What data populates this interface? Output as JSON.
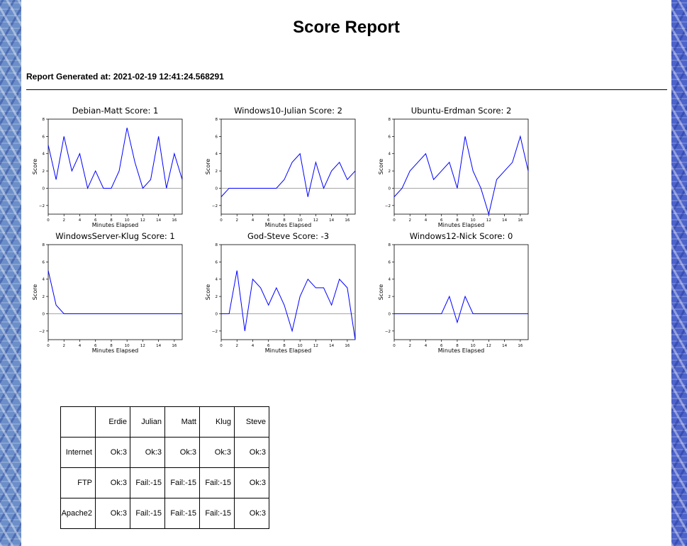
{
  "page": {
    "title": "Score Report",
    "generated_label": "Report Generated at: 2021-02-19 12:41:24.568291"
  },
  "colors": {
    "line": "#0000ff",
    "zero_line": "#999999",
    "frame": "#000000"
  },
  "chart_data": [
    {
      "type": "line",
      "title": "Debian-Matt Score: 1",
      "xlabel": "Minutes Elapsed",
      "ylabel": "Score",
      "x": [
        0,
        1,
        2,
        3,
        4,
        5,
        6,
        7,
        8,
        9,
        10,
        11,
        12,
        13,
        14,
        15,
        16,
        17
      ],
      "series": [
        {
          "values": [
            5,
            1,
            6,
            2,
            4,
            0,
            2,
            0,
            0,
            2,
            7,
            3,
            0,
            1,
            6,
            0,
            4,
            1
          ]
        }
      ],
      "xlim": [
        0,
        17
      ],
      "ylim": [
        -3,
        8
      ],
      "xticks": [
        0,
        2,
        4,
        6,
        8,
        10,
        12,
        14,
        16
      ],
      "yticks": [
        -2,
        0,
        2,
        4,
        6,
        8
      ],
      "grid": false
    },
    {
      "type": "line",
      "title": "Windows10-Julian Score: 2",
      "xlabel": "Minutes Elapsed",
      "ylabel": "Score",
      "x": [
        0,
        1,
        2,
        3,
        4,
        5,
        6,
        7,
        8,
        9,
        10,
        11,
        12,
        13,
        14,
        15,
        16,
        17
      ],
      "series": [
        {
          "values": [
            -1,
            0,
            0,
            0,
            0,
            0,
            0,
            0,
            1,
            3,
            4,
            -1,
            3,
            0,
            2,
            3,
            1,
            2
          ]
        }
      ],
      "xlim": [
        0,
        17
      ],
      "ylim": [
        -3,
        8
      ],
      "xticks": [
        0,
        2,
        4,
        6,
        8,
        10,
        12,
        14,
        16
      ],
      "yticks": [
        -2,
        0,
        2,
        4,
        6,
        8
      ],
      "grid": false
    },
    {
      "type": "line",
      "title": "Ubuntu-Erdman Score: 2",
      "xlabel": "Minutes Elapsed",
      "ylabel": "Score",
      "x": [
        0,
        1,
        2,
        3,
        4,
        5,
        6,
        7,
        8,
        9,
        10,
        11,
        12,
        13,
        14,
        15,
        16,
        17
      ],
      "series": [
        {
          "values": [
            -1,
            0,
            2,
            3,
            4,
            1,
            2,
            3,
            0,
            6,
            2,
            0,
            -3,
            1,
            2,
            3,
            6,
            2
          ]
        }
      ],
      "xlim": [
        0,
        17
      ],
      "ylim": [
        -3,
        8
      ],
      "xticks": [
        0,
        2,
        4,
        6,
        8,
        10,
        12,
        14,
        16
      ],
      "yticks": [
        -2,
        0,
        2,
        4,
        6,
        8
      ],
      "grid": false
    },
    {
      "type": "line",
      "title": "WindowsServer-Klug Score: 1",
      "xlabel": "Minutes Elapsed",
      "ylabel": "Score",
      "x": [
        0,
        1,
        2,
        3,
        4,
        5,
        6,
        7,
        8,
        9,
        10,
        11,
        12,
        13,
        14,
        15,
        16,
        17
      ],
      "series": [
        {
          "values": [
            5,
            1,
            0,
            0,
            0,
            0,
            0,
            0,
            0,
            0,
            0,
            0,
            0,
            0,
            0,
            0,
            0,
            0
          ]
        }
      ],
      "xlim": [
        0,
        17
      ],
      "ylim": [
        -3,
        8
      ],
      "xticks": [
        0,
        2,
        4,
        6,
        8,
        10,
        12,
        14,
        16
      ],
      "yticks": [
        -2,
        0,
        2,
        4,
        6,
        8
      ],
      "grid": false
    },
    {
      "type": "line",
      "title": "God-Steve Score: -3",
      "xlabel": "Minutes Elapsed",
      "ylabel": "Score",
      "x": [
        0,
        1,
        2,
        3,
        4,
        5,
        6,
        7,
        8,
        9,
        10,
        11,
        12,
        13,
        14,
        15,
        16,
        17
      ],
      "series": [
        {
          "values": [
            0,
            0,
            5,
            -2,
            4,
            3,
            1,
            3,
            1,
            -2,
            2,
            4,
            3,
            3,
            1,
            4,
            3,
            -3
          ]
        }
      ],
      "xlim": [
        0,
        17
      ],
      "ylim": [
        -3,
        8
      ],
      "xticks": [
        0,
        2,
        4,
        6,
        8,
        10,
        12,
        14,
        16
      ],
      "yticks": [
        -2,
        0,
        2,
        4,
        6,
        8
      ],
      "grid": false
    },
    {
      "type": "line",
      "title": "Windows12-Nick Score: 0",
      "xlabel": "Minutes Elapsed",
      "ylabel": "Score",
      "x": [
        0,
        1,
        2,
        3,
        4,
        5,
        6,
        7,
        8,
        9,
        10,
        11,
        12,
        13,
        14,
        15,
        16,
        17
      ],
      "series": [
        {
          "values": [
            0,
            0,
            0,
            0,
            0,
            0,
            0,
            2,
            -1,
            2,
            0,
            0,
            0,
            0,
            0,
            0,
            0,
            0
          ]
        }
      ],
      "xlim": [
        0,
        17
      ],
      "ylim": [
        -3,
        8
      ],
      "xticks": [
        0,
        2,
        4,
        6,
        8,
        10,
        12,
        14,
        16
      ],
      "yticks": [
        -2,
        0,
        2,
        4,
        6,
        8
      ],
      "grid": false
    }
  ],
  "score_table": {
    "columns": [
      "",
      "Erdie",
      "Julian",
      "Matt",
      "Klug",
      "Steve"
    ],
    "rows": [
      [
        "Internet",
        "Ok:3",
        "Ok:3",
        "Ok:3",
        "Ok:3",
        "Ok:3"
      ],
      [
        "FTP",
        "Ok:3",
        "Fail:-15",
        "Fail:-15",
        "Fail:-15",
        "Ok:3"
      ],
      [
        "Apache2",
        "Ok:3",
        "Fail:-15",
        "Fail:-15",
        "Fail:-15",
        "Ok:3"
      ]
    ]
  }
}
